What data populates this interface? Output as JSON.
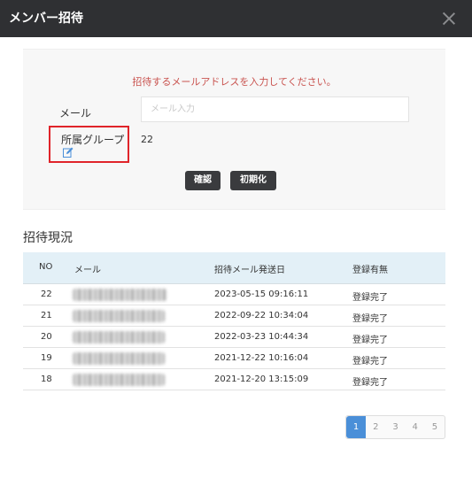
{
  "dialog": {
    "title": "メンバー招待"
  },
  "form": {
    "instruction": "招待するメールアドレスを入力してください。",
    "mail_label": "メール",
    "mail_placeholder": "メール入力",
    "mail_value": "",
    "group_label": "所属グループ",
    "group_value": "22",
    "confirm_label": "確認",
    "reset_label": "初期化"
  },
  "status_section": {
    "title": "招待現況"
  },
  "table": {
    "headers": [
      "NO",
      "メール",
      "招待メール発送日",
      "登録有無"
    ],
    "rows": [
      {
        "no": "22",
        "date": "2023-05-15 09:16:11",
        "status": "登録完了"
      },
      {
        "no": "21",
        "date": "2022-09-22 10:34:04",
        "status": "登録完了"
      },
      {
        "no": "20",
        "date": "2022-03-23 10:44:34",
        "status": "登録完了"
      },
      {
        "no": "19",
        "date": "2021-12-22 10:16:04",
        "status": "登録完了"
      },
      {
        "no": "18",
        "date": "2021-12-20 13:15:09",
        "status": "登録完了"
      }
    ]
  },
  "pagination": {
    "pages": [
      "1",
      "2",
      "3",
      "4",
      "5"
    ],
    "current": "1"
  },
  "colors": {
    "titlebar": "#2f3033",
    "instruction": "#c9534f",
    "highlight_border": "#e0242a",
    "table_header": "#e3f0f7",
    "page_active": "#4a8fd8"
  }
}
